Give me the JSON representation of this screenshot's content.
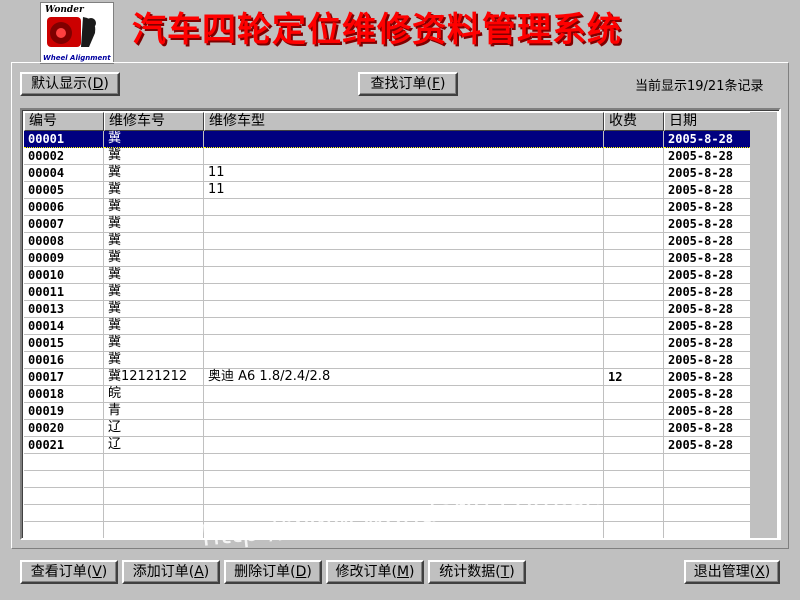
{
  "app": {
    "logo_brand": "Wonder",
    "logo_caption": "Wheel Alignment",
    "title": "汽车四轮定位维修资料管理系统"
  },
  "toolbar": {
    "default_display": {
      "label": "默认显示",
      "hotkey": "D"
    },
    "find_order": {
      "label": "查找订单",
      "hotkey": "F"
    },
    "record_status": "当前显示19/21条记录"
  },
  "table": {
    "columns": [
      "编号",
      "维修车号",
      "维修车型",
      "收费",
      "日期"
    ],
    "rows": [
      {
        "id": "00001",
        "plate": "冀",
        "model": "",
        "fee": "",
        "date": "2005-8-28",
        "selected": true
      },
      {
        "id": "00002",
        "plate": "冀",
        "model": "",
        "fee": "",
        "date": "2005-8-28"
      },
      {
        "id": "00004",
        "plate": "冀",
        "model": "11",
        "fee": "",
        "date": "2005-8-28"
      },
      {
        "id": "00005",
        "plate": "冀",
        "model": "11",
        "fee": "",
        "date": "2005-8-28"
      },
      {
        "id": "00006",
        "plate": "冀",
        "model": "",
        "fee": "",
        "date": "2005-8-28"
      },
      {
        "id": "00007",
        "plate": "冀",
        "model": "",
        "fee": "",
        "date": "2005-8-28"
      },
      {
        "id": "00008",
        "plate": "冀",
        "model": "",
        "fee": "",
        "date": "2005-8-28"
      },
      {
        "id": "00009",
        "plate": "冀",
        "model": "",
        "fee": "",
        "date": "2005-8-28"
      },
      {
        "id": "00010",
        "plate": "冀",
        "model": "",
        "fee": "",
        "date": "2005-8-28"
      },
      {
        "id": "00011",
        "plate": "冀",
        "model": "",
        "fee": "",
        "date": "2005-8-28"
      },
      {
        "id": "00013",
        "plate": "冀",
        "model": "",
        "fee": "",
        "date": "2005-8-28"
      },
      {
        "id": "00014",
        "plate": "冀",
        "model": "",
        "fee": "",
        "date": "2005-8-28"
      },
      {
        "id": "00015",
        "plate": "冀",
        "model": "",
        "fee": "",
        "date": "2005-8-28"
      },
      {
        "id": "00016",
        "plate": "冀",
        "model": "",
        "fee": "",
        "date": "2005-8-28"
      },
      {
        "id": "00017",
        "plate": "冀12121212",
        "model": "奥迪 A6 1.8/2.4/2.8",
        "fee": "12",
        "date": "2005-8-28"
      },
      {
        "id": "00018",
        "plate": "皖",
        "model": "",
        "fee": "",
        "date": "2005-8-28"
      },
      {
        "id": "00019",
        "plate": "青",
        "model": "",
        "fee": "",
        "date": "2005-8-28"
      },
      {
        "id": "00020",
        "plate": "辽",
        "model": "",
        "fee": "",
        "date": "2005-8-28"
      },
      {
        "id": "00021",
        "plate": "辽",
        "model": "",
        "fee": "",
        "date": "2005-8-28"
      }
    ],
    "empty_rows": 5
  },
  "bottom_buttons": [
    {
      "name": "view-order-button",
      "label": "查看订单",
      "hotkey": "V"
    },
    {
      "name": "add-order-button",
      "label": "添加订单",
      "hotkey": "A"
    },
    {
      "name": "delete-order-button",
      "label": "删除订单",
      "hotkey": "D"
    },
    {
      "name": "edit-order-button",
      "label": "修改订单",
      "hotkey": "M"
    },
    {
      "name": "statistics-button",
      "label": "统计数据",
      "hotkey": "T"
    }
  ],
  "exit_button": {
    "label": "退出管理",
    "hotkey": "X"
  },
  "watermark": "http://www.wonderlu.com.cn",
  "colors": {
    "window_bg": "#c0c0c0",
    "title_red": "#ff0000",
    "selection_bg": "#000080",
    "selection_fg": "#ffffff"
  }
}
